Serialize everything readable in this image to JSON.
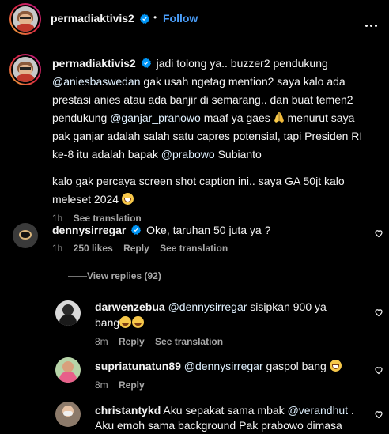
{
  "post_header": {
    "username": "permadiaktivis2",
    "separator": "•",
    "follow_label": "Follow"
  },
  "caption": {
    "username": "permadiaktivis2",
    "lines": [
      [
        "jadi tolong ya.. buzzer2 pendukung"
      ],
      [
        "@aniesbaswedan",
        " gak usah ngetag mention2 saya kalo ada"
      ],
      [
        "prestasi anies atau ada banjir di semarang.. dan buat temen2"
      ],
      [
        "pendukung ",
        "@ganjar_pranowo",
        " maaf ya gaes ",
        " menurut saya"
      ],
      [
        "pak ganjar adalah salah satu capres potensial, tapi Presiden RI"
      ],
      [
        "ke-8 itu adalah bapak ",
        "@prabowo",
        " Subianto"
      ],
      [
        "kalo gak percaya screen shot caption ini.. saya GA 50jt kalo"
      ],
      [
        "meleset 2024 "
      ]
    ],
    "time": "1h",
    "see_translation": "See translation"
  },
  "comments": [
    {
      "username": "dennysirregar",
      "verified": true,
      "text": "Oke, taruhan 50 juta ya ?",
      "time": "1h",
      "likes": "250 likes",
      "reply": "Reply",
      "see_translation": "See translation",
      "view_replies": "View replies (92)"
    }
  ],
  "replies": [
    {
      "username": "darwenzebua",
      "mention": "@dennysirregar",
      "text_after": " sisipkan 900 ya",
      "line2": "bang",
      "time": "8m",
      "reply": "Reply",
      "see_translation": "See translation"
    },
    {
      "username": "supriatunatun89",
      "mention": "@dennysirregar",
      "text_after": " gaspol bang ",
      "time": "8m",
      "reply": "Reply"
    },
    {
      "username": "christantykd",
      "text_before": "Aku sepakat sama mbak ",
      "mention": "@verandhut",
      "text_after": " .",
      "line2": "Aku emoh sama background Pak prabowo dimasa"
    }
  ],
  "colors": {
    "link": "#4a9df8",
    "muted": "#a8a8a8",
    "background": "#000000"
  }
}
